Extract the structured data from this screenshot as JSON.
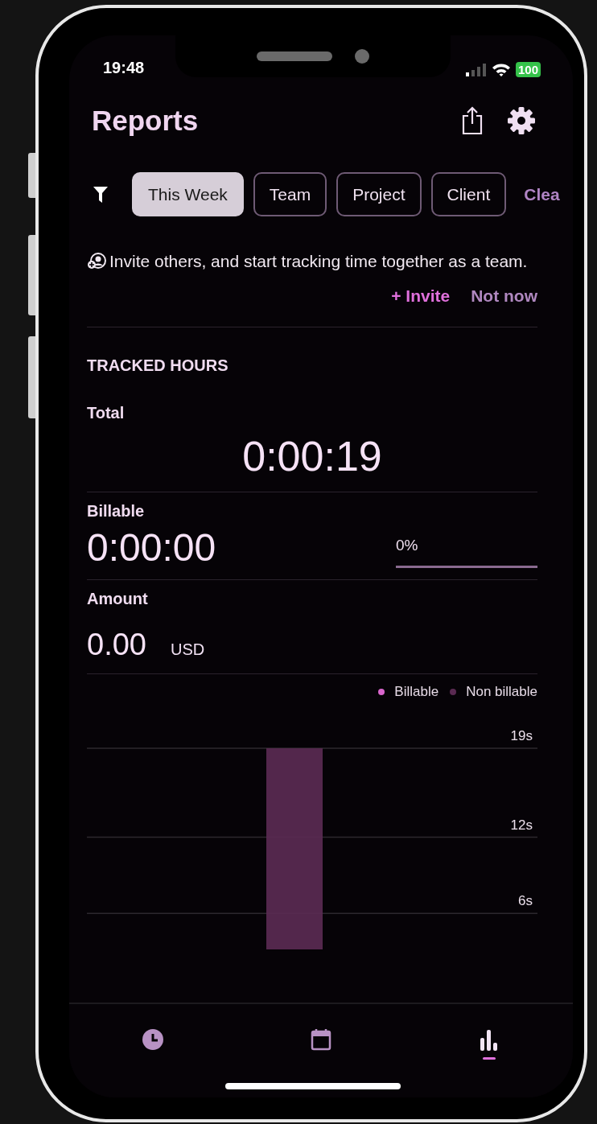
{
  "status_bar": {
    "time": "19:48",
    "battery": "100"
  },
  "header": {
    "title": "Reports"
  },
  "filters": [
    {
      "label": "This Week",
      "selected": true
    },
    {
      "label": "Team",
      "selected": false
    },
    {
      "label": "Project",
      "selected": false
    },
    {
      "label": "Client",
      "selected": false
    }
  ],
  "clear_link": "Clea",
  "invite_banner": {
    "text": "Invite others, and start tracking time together as a team.",
    "invite": "+ Invite",
    "dismiss": "Not now"
  },
  "tracked_hours": {
    "heading": "TRACKED HOURS",
    "total_label": "Total",
    "total": "0:00:19",
    "billable_label": "Billable",
    "billable": "0:00:00",
    "billable_percent": "0%",
    "level": 0,
    "amount_label": "Amount",
    "amount": "0.00",
    "currency": "USD"
  },
  "chart": {
    "chart_data": {
      "type": "bar",
      "stacked": true,
      "ylim": [
        0,
        19
      ],
      "yticks": [
        {
          "value": 6,
          "label": "6s"
        },
        {
          "value": 12,
          "label": "12s"
        },
        {
          "value": 19,
          "label": "19s"
        }
      ],
      "series": [
        {
          "name": "Billable",
          "color": "#d966cc",
          "values": [
            0,
            0,
            0,
            0,
            0,
            0,
            0
          ]
        },
        {
          "name": "Non billable",
          "color": "#5a2a52",
          "values": [
            0,
            0,
            0,
            19,
            0,
            0,
            0
          ]
        }
      ]
    }
  },
  "tab_bar": [
    {
      "kind": "timer",
      "selected": false
    },
    {
      "kind": "calendar",
      "selected": false
    },
    {
      "kind": "reports",
      "selected": true
    }
  ]
}
